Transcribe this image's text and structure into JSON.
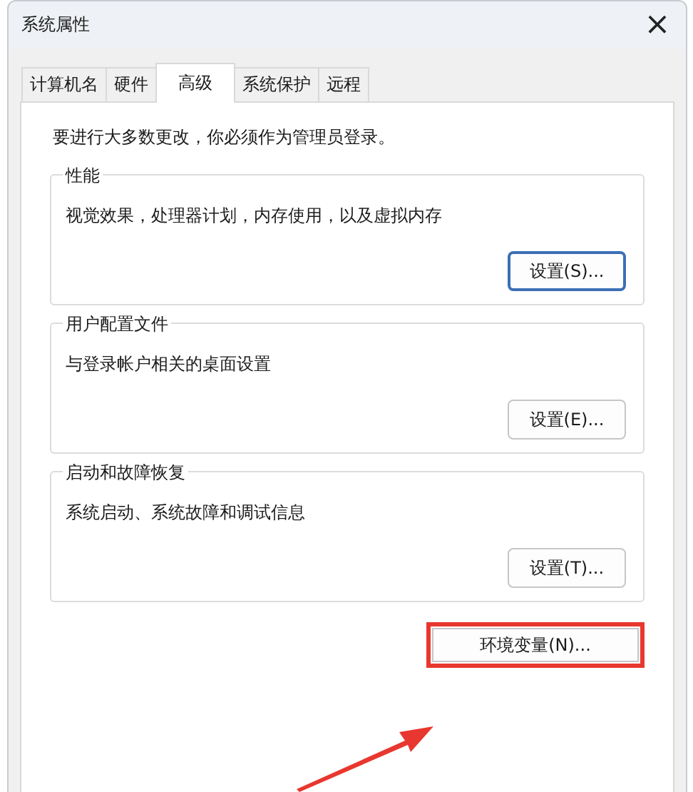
{
  "window": {
    "title": "系统属性",
    "close": "×"
  },
  "tabs": [
    {
      "label": "计算机名",
      "selected": false
    },
    {
      "label": "硬件",
      "selected": false
    },
    {
      "label": "高级",
      "selected": true
    },
    {
      "label": "系统保护",
      "selected": false
    },
    {
      "label": "远程",
      "selected": false
    }
  ],
  "notice": "要进行大多数更改，你必须作为管理员登录。",
  "groups": [
    {
      "title": "性能",
      "description": "视觉效果，处理器计划，内存使用，以及虚拟内存",
      "button": "设置(S)...",
      "focused": true
    },
    {
      "title": "用户配置文件",
      "description": "与登录帐户相关的桌面设置",
      "button": "设置(E)...",
      "focused": false
    },
    {
      "title": "启动和故障恢复",
      "description": "系统启动、系统故障和调试信息",
      "button": "设置(T)...",
      "focused": false
    }
  ],
  "env_button": {
    "label": "环境变量(N)...",
    "highlighted": true
  },
  "callout_arrow": true
}
